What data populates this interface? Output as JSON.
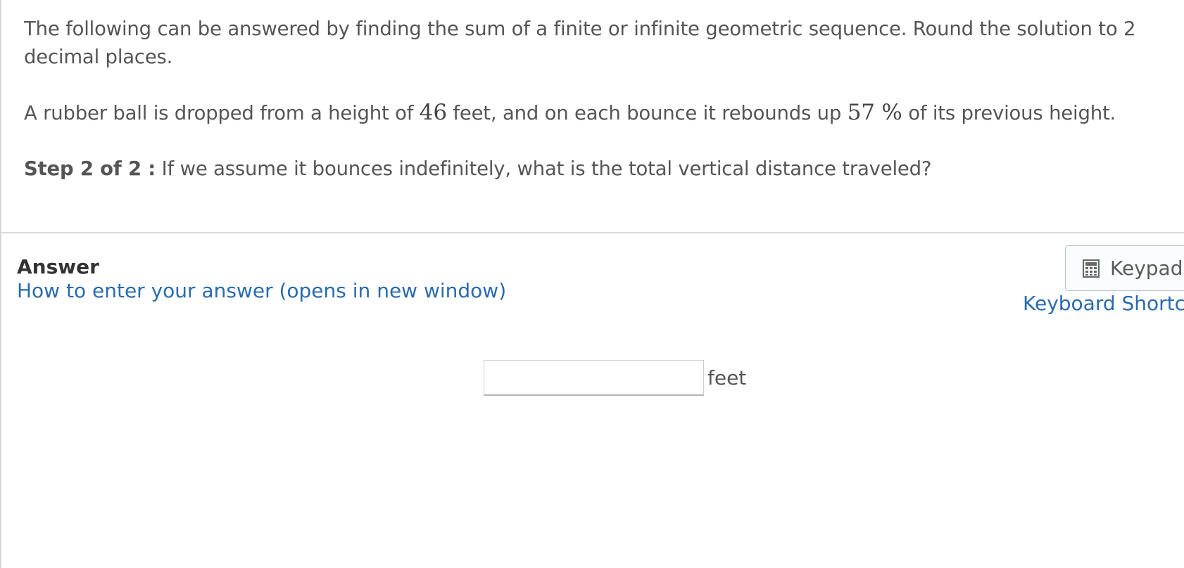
{
  "question": {
    "intro": "The following can be answered by finding the sum of a finite or infinite geometric sequence. Round the solution to 2 decimal places.",
    "problem": {
      "part1": "A rubber ball is dropped from a height of ",
      "height": "46",
      "part2": " feet, and on each bounce it rebounds up ",
      "percent": "57 %",
      "part3": " of its previous height."
    },
    "step": {
      "label": "Step 2 of 2 :",
      "text": " If we assume it bounces indefinitely, what is the total vertical distance traveled?"
    }
  },
  "answer": {
    "label": "Answer",
    "help_link": "How to enter your answer (opens in new window)",
    "input_value": "",
    "unit": "feet"
  },
  "tools": {
    "keypad_label": "Keypad",
    "keypad_icon": "calculator-icon",
    "shortcuts_link": "Keyboard Shortcuts"
  }
}
